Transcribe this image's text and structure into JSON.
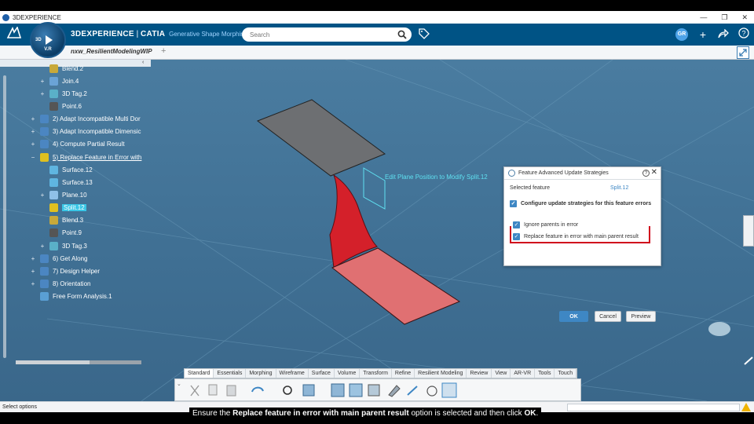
{
  "window": {
    "title": "3DEXPERIENCE",
    "controls": [
      "—",
      "❐",
      "✕"
    ]
  },
  "header": {
    "brand_prefix": "3DEXPERIENCE",
    "brand_sep": " | ",
    "brand_product": "CATIA",
    "app_name": "Generative Shape Morphing",
    "compass_version": "V.R",
    "compass_3d": "3D",
    "search_placeholder": "Search",
    "avatar_initials": "GR"
  },
  "tabs": {
    "doc_tab": "nxw_ResilientModelingWIP",
    "add": "+"
  },
  "tree": {
    "items": [
      {
        "label": "Blend.2",
        "exp": "",
        "icon": "blend-icon"
      },
      {
        "label": "Join.4",
        "exp": "+",
        "icon": "join-icon"
      },
      {
        "label": "3D Tag.2",
        "exp": "+",
        "icon": "tag3d-icon"
      },
      {
        "label": "Point.6",
        "exp": "",
        "icon": "point-icon"
      },
      {
        "label": "2) Adapt Incompatible Multi Dor",
        "exp": "+",
        "icon": "adapt-icon"
      },
      {
        "label": "3) Adapt Incompatible Dimensic",
        "exp": "+",
        "icon": "adapt-icon"
      },
      {
        "label": "4) Compute Partial Result",
        "exp": "+",
        "icon": "compute-icon"
      },
      {
        "label": "5) Replace Feature in Error with",
        "exp": "−",
        "icon": "replace-icon"
      },
      {
        "label": "Surface.12",
        "exp": "",
        "icon": "surface-icon"
      },
      {
        "label": "Surface.13",
        "exp": "",
        "icon": "surface-icon"
      },
      {
        "label": "Plane.10",
        "exp": "+",
        "icon": "plane-icon"
      },
      {
        "label": "Split.12",
        "exp": "",
        "icon": "split-icon"
      },
      {
        "label": "Blend.3",
        "exp": "",
        "icon": "blend-icon"
      },
      {
        "label": "Point.9",
        "exp": "",
        "icon": "point-icon"
      },
      {
        "label": "3D Tag.3",
        "exp": "+",
        "icon": "tag3d-icon"
      },
      {
        "label": "6) Get Along",
        "exp": "+",
        "icon": "adapt-icon"
      },
      {
        "label": "7) Design Helper",
        "exp": "+",
        "icon": "adapt-icon"
      },
      {
        "label": "8) Orientation",
        "exp": "+",
        "icon": "adapt-icon"
      },
      {
        "label": "Free Form Analysis.1",
        "exp": "",
        "icon": "analysis-icon"
      }
    ],
    "collapse": "‹"
  },
  "viewport": {
    "edit_plane_label": "Edit Plane Position to Modify Split.12"
  },
  "dialog": {
    "title": "Feature Advanced Update Strategies",
    "help": "?",
    "close": "✕",
    "selected_feature_label": "Selected feature",
    "selected_feature_value": "Split.12",
    "configure_label": "Configure update strategies for this feature errors",
    "ignore_label": "Ignore parents in error",
    "replace_label": "Replace feature in error with main parent result",
    "check": "✓",
    "ok": "OK",
    "cancel": "Cancel",
    "preview": "Preview"
  },
  "action_bar": {
    "tabs": [
      "Standard",
      "Essentials",
      "Morphing",
      "Wireframe",
      "Surface",
      "Volume",
      "Transform",
      "Refine",
      "Resilient Modeling",
      "Review",
      "View",
      "AR-VR",
      "Tools",
      "Touch"
    ],
    "active_tab": "Standard",
    "collapse": "⌄"
  },
  "status": {
    "text": "Select options"
  },
  "caption": {
    "prefix": "Ensure the ",
    "bold": "Replace feature in error with main parent result",
    "middle": " option is selected and then click ",
    "ok": "OK",
    "suffix": "."
  },
  "colors": {
    "accent": "#005385",
    "check": "#3e87c4",
    "highlight": "#d0021b",
    "selected_bg": "#39c6e6"
  }
}
